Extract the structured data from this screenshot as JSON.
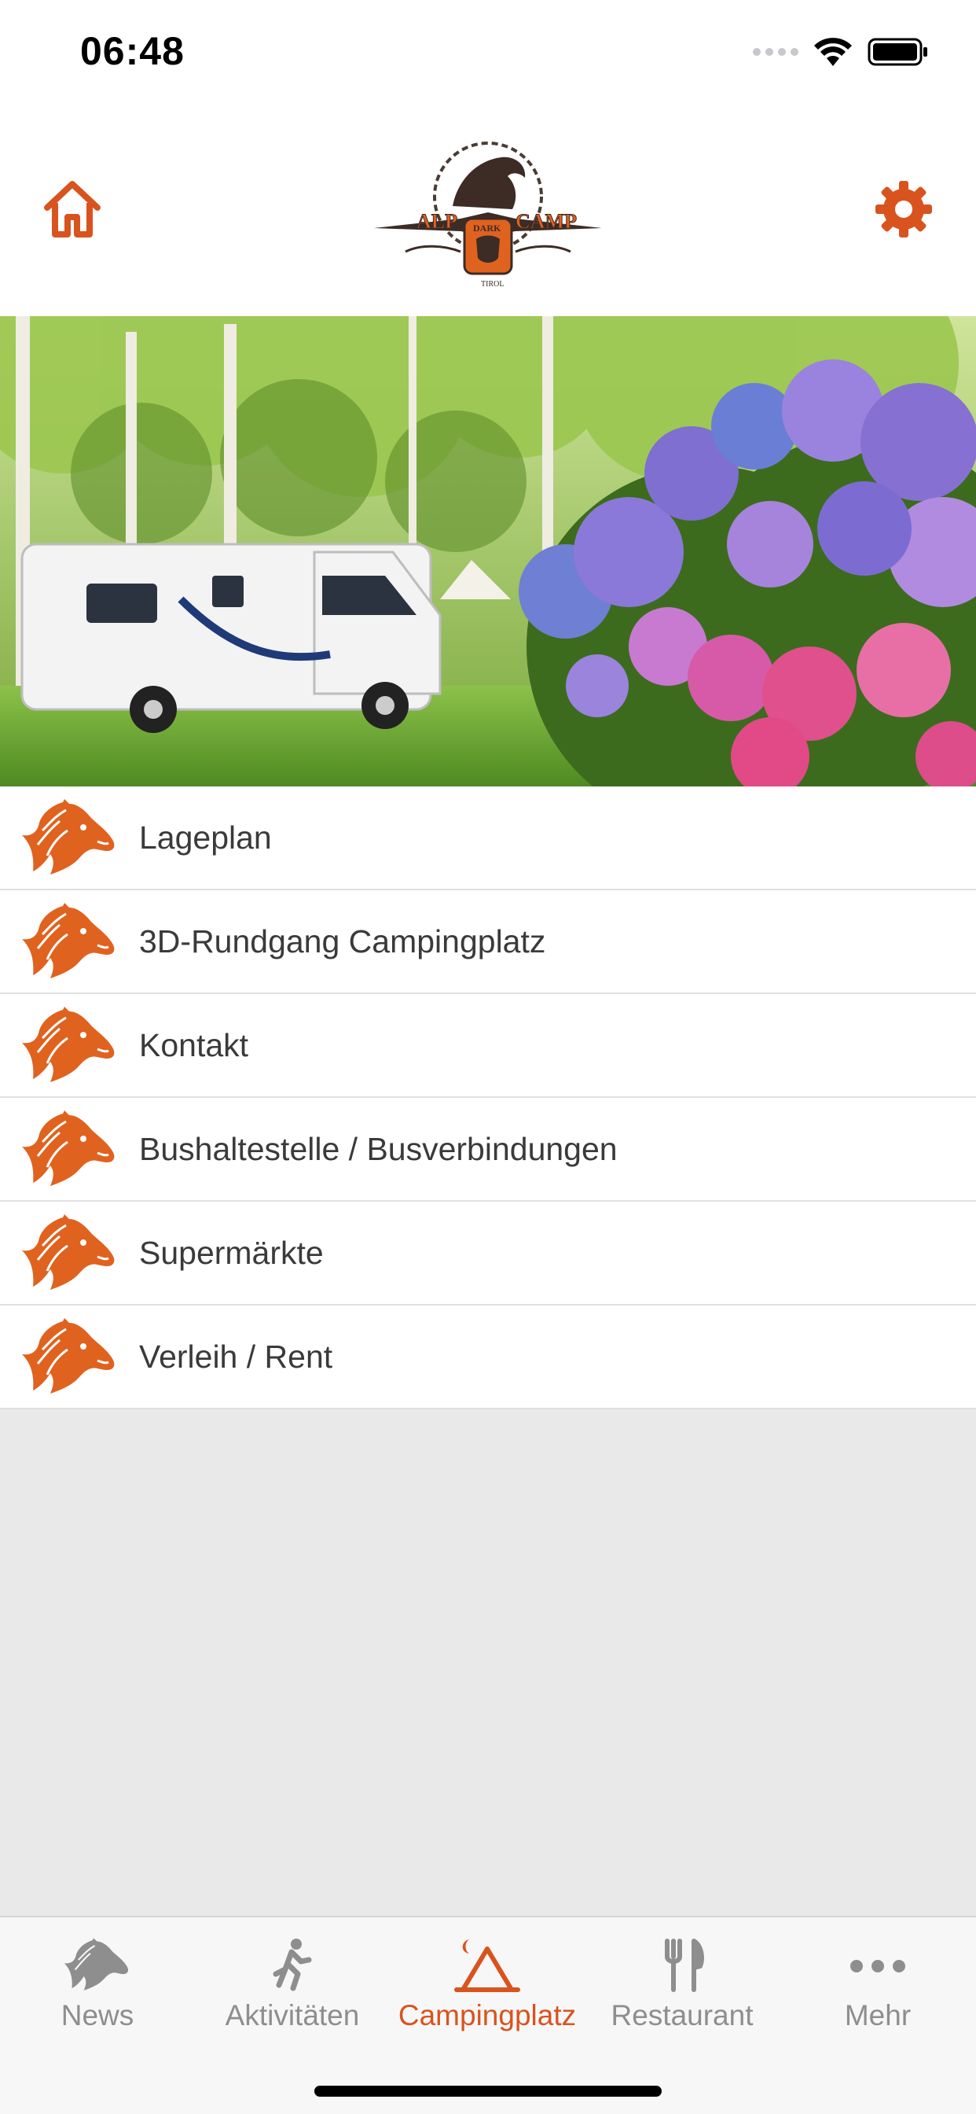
{
  "status_bar": {
    "time": "06:48"
  },
  "header": {
    "home_icon": "home-icon",
    "settings_icon": "gear-icon",
    "logo_text_left": "ALP",
    "logo_text_center": "DARK",
    "logo_text_right": "CAMP",
    "logo_text_bottom": "TIROL"
  },
  "menu": {
    "items": [
      {
        "label": "Lageplan"
      },
      {
        "label": "3D-Rundgang Campingplatz"
      },
      {
        "label": "Kontakt"
      },
      {
        "label": "Bushaltestelle / Busverbindungen"
      },
      {
        "label": "Supermärkte"
      },
      {
        "label": "Verleih / Rent"
      }
    ]
  },
  "tabs": [
    {
      "label": "News",
      "icon": "horse-icon",
      "active": false
    },
    {
      "label": "Aktivitäten",
      "icon": "running-icon",
      "active": false
    },
    {
      "label": "Campingplatz",
      "icon": "tent-icon",
      "active": true
    },
    {
      "label": "Restaurant",
      "icon": "fork-knife-icon",
      "active": false
    },
    {
      "label": "Mehr",
      "icon": "more-icon",
      "active": false
    }
  ],
  "colors": {
    "accent": "#d9531e",
    "inactive": "#8e8e8e",
    "background": "#e9e9e9"
  }
}
